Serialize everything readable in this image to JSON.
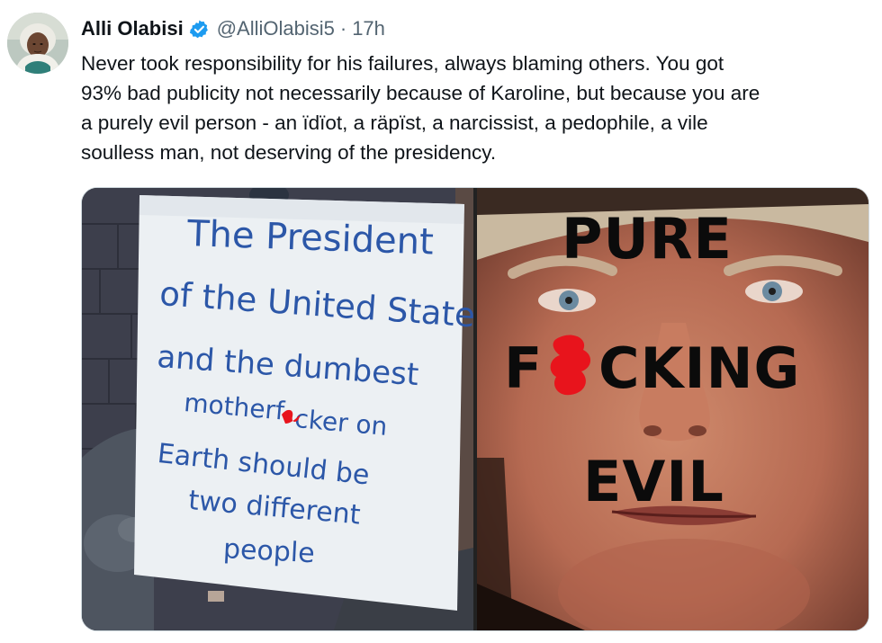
{
  "tweet": {
    "author": {
      "display_name": "Alli Olabisi",
      "handle": "@AlliOlabisi5",
      "verified": true
    },
    "separator": "·",
    "time": "17h",
    "text_lines": [
      "Never took responsibility for his failures, always blaming others. You got",
      "93% bad publicity not necessarily because of Karoline, but because you are",
      "a purely evil person - an ïdïot, a räpïst, a narcissist, a pedophile, a vile",
      "soulless man, not deserving of the presidency."
    ]
  },
  "media": {
    "left_image": {
      "sign_lines": [
        "The President",
        "of the United States",
        "and the dumbest",
        "motherf",
        "cker on",
        "Earth should be",
        "two different",
        "people"
      ]
    },
    "right_image": {
      "overlay_lines": [
        "PURE",
        "F",
        "CKING",
        "EVIL"
      ]
    }
  },
  "colors": {
    "verified_blue": "#1d9bf0",
    "secondary_text": "#536471",
    "primary_text": "#0f1419",
    "sign_ink": "#2c57a8",
    "censor_red": "#e8141c"
  }
}
